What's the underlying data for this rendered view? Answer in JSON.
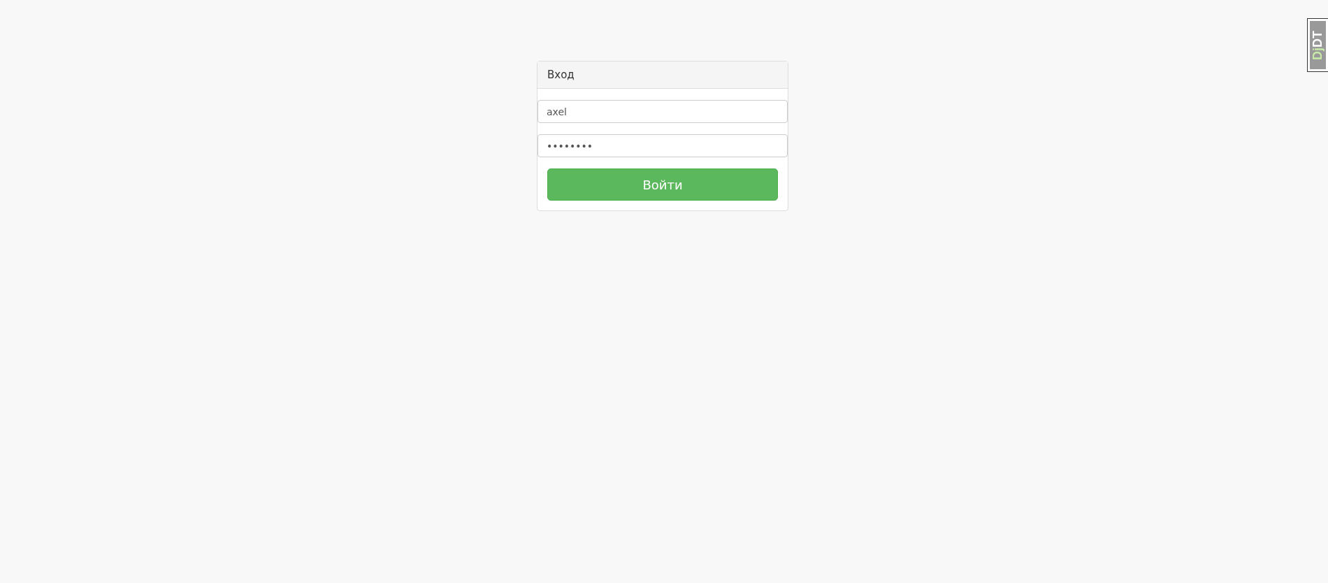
{
  "login": {
    "title": "Вход",
    "username": {
      "value": "axel"
    },
    "password": {
      "value": "••••••••"
    },
    "submit": "Войти"
  },
  "debug_toolbar_handle": [
    {
      "text": "Dj",
      "color": "#c8eaa8"
    },
    {
      "text": "DT",
      "color": "#ffffff"
    }
  ]
}
